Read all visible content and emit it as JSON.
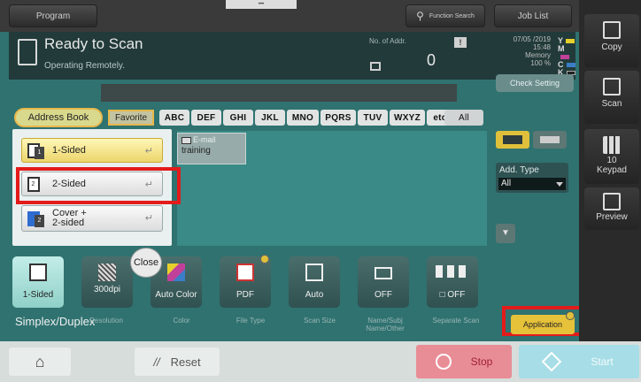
{
  "topbar": {
    "program_label": "Program",
    "top_tab_label": "•••",
    "search_label": "Function Search",
    "joblist_label": "Job List"
  },
  "status": {
    "title": "Ready to Scan",
    "subtitle": "Operating Remotely.",
    "addr_label": "No. of Addr.",
    "addr_count": "0",
    "date": "07/05 /2019",
    "time": "15:48",
    "memory_label": "Memory",
    "memory_pct": "100 %",
    "toner": [
      {
        "letter": "Y",
        "color": "#e6d02b"
      },
      {
        "letter": "M",
        "color": "#c0409a"
      },
      {
        "letter": "C",
        "color": "#3a7ec8"
      },
      {
        "letter": "K",
        "color": "#222222"
      }
    ],
    "check_setting": "Check Setting"
  },
  "address": {
    "tab_address_book": "Address Book",
    "tab_favorite": "Favorite",
    "alpha": [
      "ABC",
      "DEF",
      "GHI",
      "JKL",
      "MNO",
      "PQRS",
      "TUV",
      "WXYZ",
      "etc"
    ],
    "all_label": "All",
    "entry": {
      "type": "E-mail",
      "name": "training"
    },
    "add_type_label": "Add. Type",
    "add_type_value": "All"
  },
  "dropdown": {
    "options": [
      {
        "label": "1-Sided",
        "selected": true
      },
      {
        "label": "2-Sided",
        "selected": false
      },
      {
        "label": "Cover +\n2-sided",
        "selected": false
      }
    ],
    "close_label": "Close"
  },
  "functions": [
    {
      "value": "1-Sided",
      "label": "Simplex/Duplex"
    },
    {
      "value": "300dpi",
      "label": "Resolution"
    },
    {
      "value": "Auto Color",
      "label": "Color"
    },
    {
      "value": "PDF",
      "label": "File Type"
    },
    {
      "value": "Auto",
      "label": "Scan Size"
    },
    {
      "value": "OFF",
      "label": "Name/Subj Name/Other"
    },
    {
      "value": "OFF",
      "label": "Separate Scan"
    }
  ],
  "application_label": "Application",
  "bottom": {
    "reset_label": "Reset",
    "stop_label": "Stop",
    "start_label": "Start"
  },
  "side": {
    "copy_label": "Copy",
    "scan_label": "Scan",
    "keypad_num": "10",
    "keypad_label": "Keypad",
    "preview_label": "Preview"
  }
}
